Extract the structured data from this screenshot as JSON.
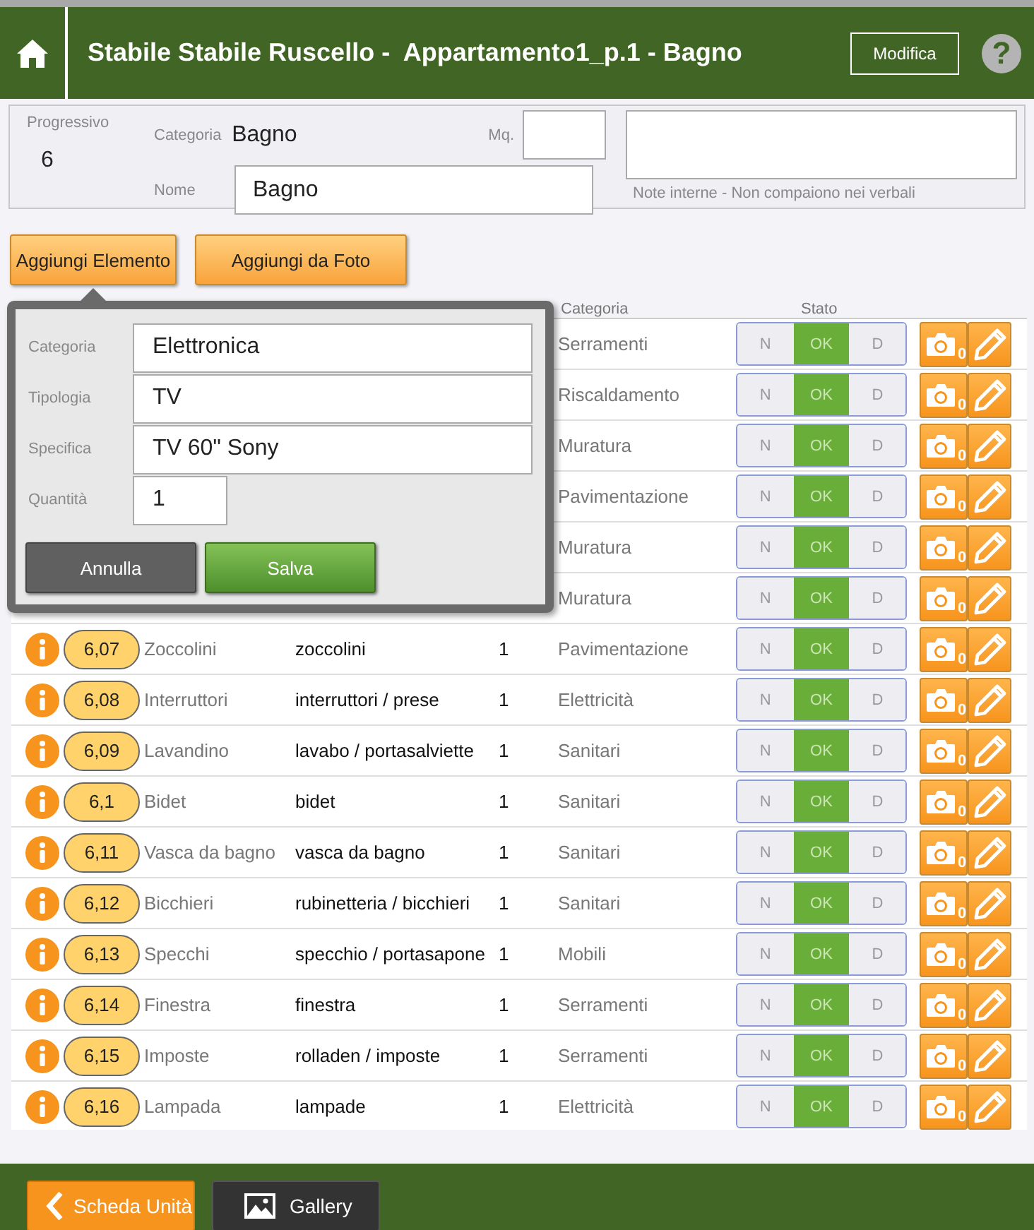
{
  "header": {
    "title": "Stabile Stabile Ruscello -  Appartamento1_p.1 - Bagno",
    "edit_button": "Modifica",
    "help": "?"
  },
  "unit": {
    "progressivo_label": "Progressivo",
    "progressivo": "6",
    "categoria_label": "Categoria",
    "categoria": "Bagno",
    "mq_label": "Mq.",
    "nome_label": "Nome",
    "nome": "Bagno",
    "note_caption": "Note interne - Non compaiono nei verbali"
  },
  "actions": [
    "Aggiungi Elemento",
    "Aggiungi da Foto"
  ],
  "table": {
    "columns": [
      {
        "label": "Categoria"
      },
      {
        "label": "Stato"
      }
    ],
    "rows": [
      {
        "category": "Serramenti",
        "photos": "0",
        "states": [
          {
            "label": "N",
            "selected": false
          },
          {
            "label": "OK",
            "selected": true
          },
          {
            "label": "D",
            "selected": false
          }
        ]
      },
      {
        "category": "Riscaldamento",
        "photos": "0",
        "states": [
          {
            "label": "N",
            "selected": false
          },
          {
            "label": "OK",
            "selected": true
          },
          {
            "label": "D",
            "selected": false
          }
        ]
      },
      {
        "category": "Muratura",
        "photos": "0",
        "states": [
          {
            "label": "N",
            "selected": false
          },
          {
            "label": "OK",
            "selected": true
          },
          {
            "label": "D",
            "selected": false
          }
        ]
      },
      {
        "category": "Pavimentazione",
        "photos": "0",
        "states": [
          {
            "label": "N",
            "selected": false
          },
          {
            "label": "OK",
            "selected": true
          },
          {
            "label": "D",
            "selected": false
          }
        ]
      },
      {
        "category": "Muratura",
        "photos": "0",
        "states": [
          {
            "label": "N",
            "selected": false
          },
          {
            "label": "OK",
            "selected": true
          },
          {
            "label": "D",
            "selected": false
          }
        ]
      },
      {
        "category": "Muratura",
        "photos": "0",
        "states": [
          {
            "label": "N",
            "selected": false
          },
          {
            "label": "OK",
            "selected": true
          },
          {
            "label": "D",
            "selected": false
          }
        ]
      },
      {
        "code": "6,07",
        "name": "Zoccolini",
        "type": "zoccolini",
        "qty": "1",
        "category": "Pavimentazione",
        "photos": "0",
        "states": [
          {
            "label": "N",
            "selected": false
          },
          {
            "label": "OK",
            "selected": true
          },
          {
            "label": "D",
            "selected": false
          }
        ]
      },
      {
        "code": "6,08",
        "name": "Interruttori",
        "type": "interruttori / prese",
        "qty": "1",
        "category": "Elettricità",
        "photos": "0",
        "states": [
          {
            "label": "N",
            "selected": false
          },
          {
            "label": "OK",
            "selected": true
          },
          {
            "label": "D",
            "selected": false
          }
        ]
      },
      {
        "code": "6,09",
        "name": "Lavandino",
        "type": "lavabo / portasalviette",
        "qty": "1",
        "category": "Sanitari",
        "photos": "0",
        "states": [
          {
            "label": "N",
            "selected": false
          },
          {
            "label": "OK",
            "selected": true
          },
          {
            "label": "D",
            "selected": false
          }
        ]
      },
      {
        "code": "6,1",
        "name": "Bidet",
        "type": "bidet",
        "qty": "1",
        "category": "Sanitari",
        "photos": "0",
        "states": [
          {
            "label": "N",
            "selected": false
          },
          {
            "label": "OK",
            "selected": true
          },
          {
            "label": "D",
            "selected": false
          }
        ]
      },
      {
        "code": "6,11",
        "name": "Vasca da bagno",
        "type": "vasca da bagno",
        "qty": "1",
        "category": "Sanitari",
        "photos": "0",
        "states": [
          {
            "label": "N",
            "selected": false
          },
          {
            "label": "OK",
            "selected": true
          },
          {
            "label": "D",
            "selected": false
          }
        ]
      },
      {
        "code": "6,12",
        "name": "Bicchieri",
        "type": "rubinetteria / bicchieri",
        "qty": "1",
        "category": "Sanitari",
        "photos": "0",
        "states": [
          {
            "label": "N",
            "selected": false
          },
          {
            "label": "OK",
            "selected": true
          },
          {
            "label": "D",
            "selected": false
          }
        ]
      },
      {
        "code": "6,13",
        "name": "Specchi",
        "type": "specchio / portasapone",
        "qty": "1",
        "category": "Mobili",
        "photos": "0",
        "states": [
          {
            "label": "N",
            "selected": false
          },
          {
            "label": "OK",
            "selected": true
          },
          {
            "label": "D",
            "selected": false
          }
        ]
      },
      {
        "code": "6,14",
        "name": "Finestra",
        "type": "finestra",
        "qty": "1",
        "category": "Serramenti",
        "photos": "0",
        "states": [
          {
            "label": "N",
            "selected": false
          },
          {
            "label": "OK",
            "selected": true
          },
          {
            "label": "D",
            "selected": false
          }
        ]
      },
      {
        "code": "6,15",
        "name": "Imposte",
        "type": "rolladen / imposte",
        "qty": "1",
        "category": "Serramenti",
        "photos": "0",
        "states": [
          {
            "label": "N",
            "selected": false
          },
          {
            "label": "OK",
            "selected": true
          },
          {
            "label": "D",
            "selected": false
          }
        ]
      },
      {
        "code": "6,16",
        "name": "Lampada",
        "type": "lampade",
        "qty": "1",
        "category": "Elettricità",
        "photos": "0",
        "states": [
          {
            "label": "N",
            "selected": false
          },
          {
            "label": "OK",
            "selected": true
          },
          {
            "label": "D",
            "selected": false
          }
        ]
      }
    ]
  },
  "popup": {
    "fields": [
      {
        "label": "Categoria",
        "value": "Elettronica",
        "kind": "wide"
      },
      {
        "label": "Tipologia",
        "value": "TV",
        "kind": "wide"
      },
      {
        "label": "Specifica",
        "value": "TV 60\" Sony",
        "kind": "wide"
      },
      {
        "label": "Quantità",
        "value": "1",
        "kind": "short"
      }
    ],
    "buttons": [
      {
        "label": "Annulla",
        "kind": "cancel"
      },
      {
        "label": "Salva",
        "kind": "save"
      }
    ]
  },
  "footer": {
    "buttons": [
      {
        "label": "Scheda Unità",
        "kind": "back"
      },
      {
        "label": "Gallery",
        "kind": "gallery"
      }
    ]
  }
}
